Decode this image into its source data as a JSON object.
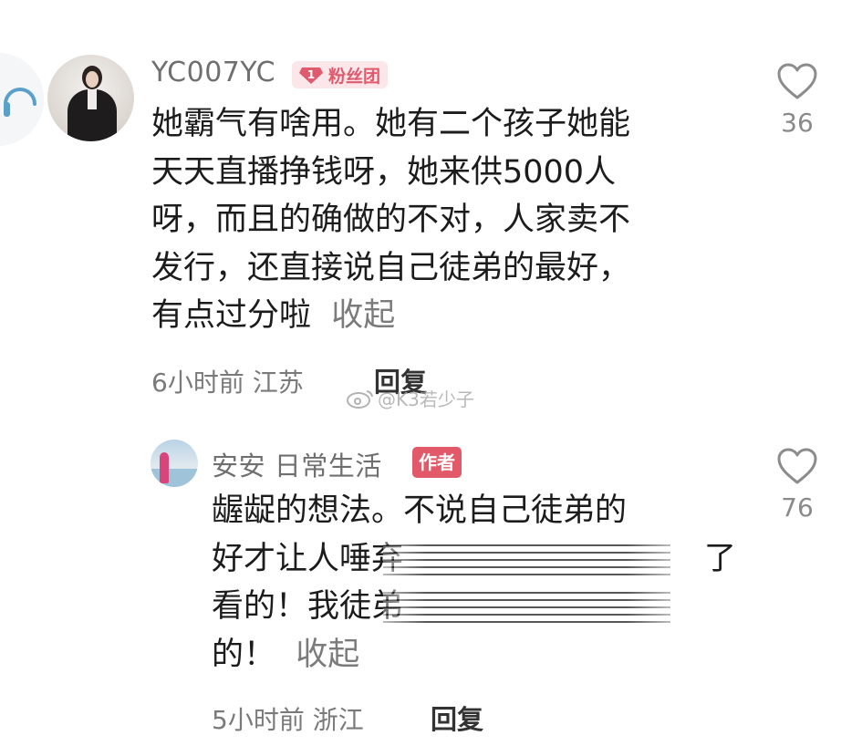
{
  "comment1": {
    "username": "YC007YC",
    "badge_level": "1",
    "badge_label": "粉丝团",
    "lines": [
      "她霸气有啥用。她有二个孩子她能",
      "天天直播挣钱呀，她来供5000人",
      "呀，而且的确做的不对，人家卖不",
      "发行，还直接说自己徒弟的最好，",
      "有点过分啦"
    ],
    "collapse_label": "收起",
    "time": "6小时前",
    "location": "江苏",
    "reply_label": "回复",
    "likes": "36"
  },
  "watermark": "@K3若少子",
  "reply1": {
    "username": "安安 日常生活",
    "author_badge": "作者",
    "line1": "龌龊的想法。不说自己徒弟的",
    "line2_start": "好才让人唾弃",
    "line2_end": "了",
    "line3_start": "看的！我徒弟",
    "line4": "的！",
    "collapse_label": "收起",
    "time": "5小时前",
    "location": "浙江",
    "reply_label": "回复",
    "likes": "76"
  },
  "icons": [
    "headphone-icon",
    "heart-icon",
    "fan-badge-gem-icon",
    "weibo-icon"
  ],
  "colors": {
    "badge_fans_bg": "#fbe7ea",
    "badge_fans_text": "#e05a6e",
    "author_badge_bg": "#e25a6a"
  }
}
